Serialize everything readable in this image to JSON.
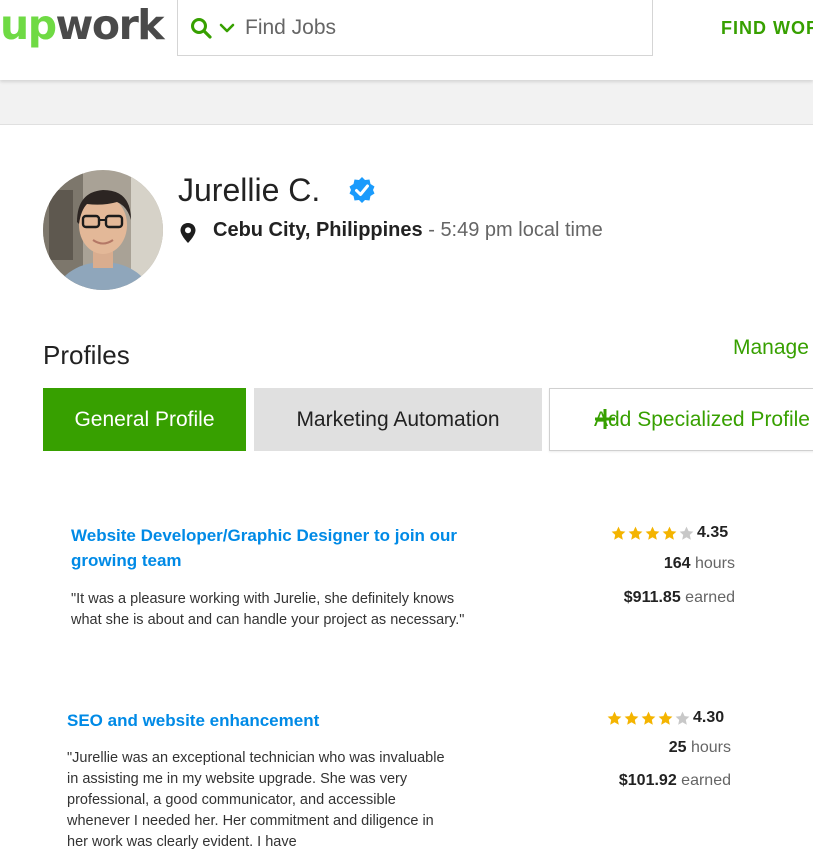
{
  "colors": {
    "brand_green": "#37a000",
    "logo_green": "#6fda44",
    "link_blue": "#008ae6",
    "star_gold": "#f4b400",
    "verified_blue": "#1a9bfc"
  },
  "header": {
    "logo_up": "up",
    "logo_work": "work",
    "search_placeholder": "Find Jobs",
    "nav_find_work": "FIND WORK"
  },
  "profile": {
    "name": "Jurellie C.",
    "city": "Cebu City, Philippines",
    "separator": " - ",
    "local_time": "5:49 pm local time"
  },
  "profiles_section": {
    "title": "Profiles",
    "manage_label": "Manage",
    "tabs": [
      {
        "label": "General Profile",
        "active": true
      },
      {
        "label": "Marketing Automation",
        "active": false
      },
      {
        "label": "Add Specialized Profile",
        "active": false
      }
    ]
  },
  "feedback": [
    {
      "title": "Website Developer/Graphic Designer to join our growing team",
      "quote": "\"It was a pleasure working with Jurelie, she definitely knows what she is about and can handle your project as necessary.\"",
      "rating": "4.35",
      "stars_filled": 4,
      "hours": "164",
      "hours_unit": "hours",
      "earned": "$911.85",
      "earned_unit": "earned"
    },
    {
      "title": "SEO and website enhancement",
      "quote": "\"Jurellie was an exceptional technician who was invaluable in assisting me in my website upgrade. She was very professional, a good communicator, and accessible whenever I needed her.  Her commitment and diligence in her work was clearly evident.  I have",
      "rating": "4.30",
      "stars_filled": 4,
      "hours": "25",
      "hours_unit": "hours",
      "earned": "$101.92",
      "earned_unit": "earned"
    }
  ]
}
